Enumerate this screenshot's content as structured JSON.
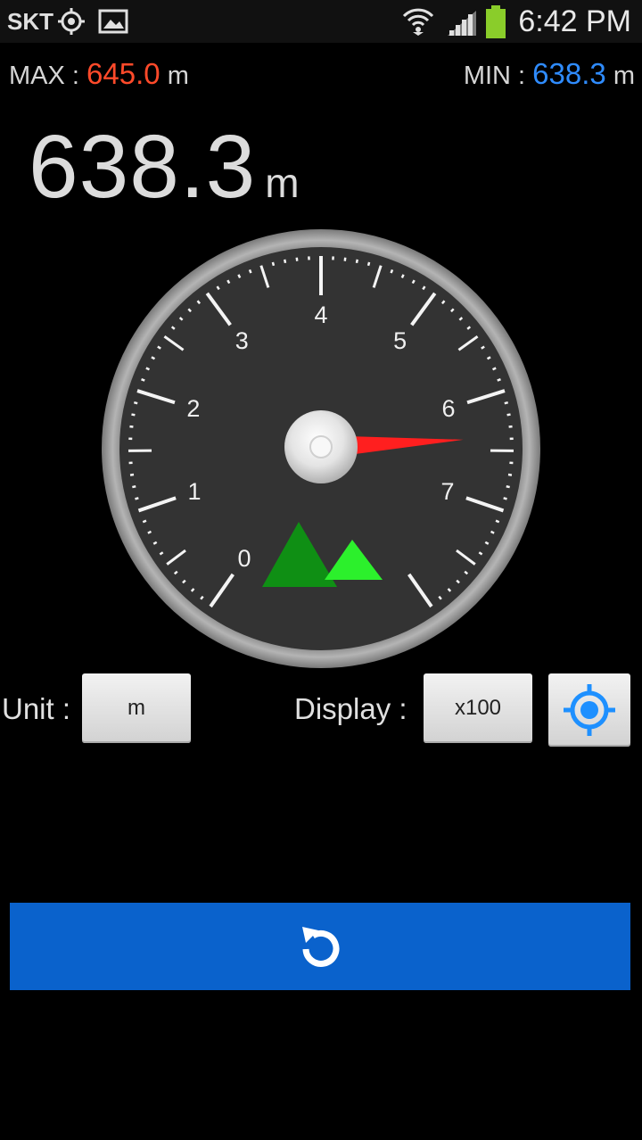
{
  "statusbar": {
    "carrier": "SKT",
    "time": "6:42 PM",
    "icons": [
      "gps-icon",
      "gallery-icon",
      "wifi-icon",
      "signal-icon",
      "battery-icon"
    ]
  },
  "stats": {
    "max_label": "MAX :",
    "max_value": "645.0",
    "max_unit": "m",
    "min_label": "MIN :",
    "min_value": "638.3",
    "min_unit": "m"
  },
  "readout": {
    "value": "638.3",
    "unit": "m"
  },
  "gauge": {
    "labels": [
      "0",
      "1",
      "2",
      "3",
      "4",
      "5",
      "6",
      "7"
    ],
    "scale_min": 0,
    "scale_max": 8,
    "needle_value": 6.383,
    "colors": {
      "needle": "#ff1f1f",
      "face": "#333333",
      "bezel": "#9a9a9a",
      "mountain_dark": "#0f8f14",
      "mountain_light": "#2cf02c"
    }
  },
  "controls": {
    "unit_label": "Unit :",
    "unit_value": "m",
    "display_label": "Display :",
    "display_value": "x100",
    "locate_icon": "target-icon"
  },
  "reset": {
    "icon": "refresh-icon",
    "color": "#0a62cc"
  }
}
